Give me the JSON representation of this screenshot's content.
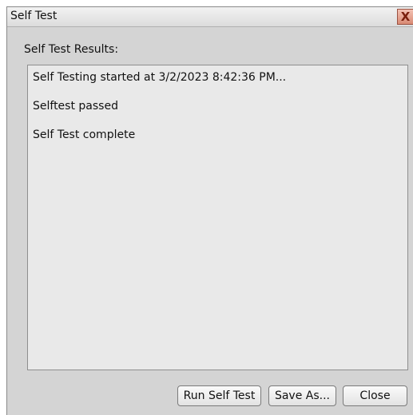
{
  "window": {
    "title": "Self Test"
  },
  "results": {
    "label": "Self Test Results:",
    "lines": [
      "Self Testing started at 3/2/2023 8:42:36 PM...",
      "Selftest passed",
      "Self Test complete"
    ]
  },
  "buttons": {
    "run_label": "Run Self Test",
    "save_label": "Save As...",
    "close_label": "Close"
  },
  "colors": {
    "dialog_background": "#d4d4d4",
    "results_background": "#e9e9e9",
    "close_x_accent": "#d98a74"
  },
  "icons": {
    "close": "close-icon"
  }
}
